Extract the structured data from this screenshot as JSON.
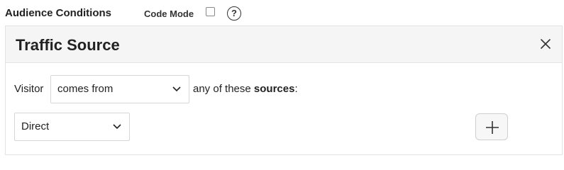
{
  "header": {
    "title": "Audience Conditions",
    "code_mode_label": "Code Mode",
    "help_glyph": "?"
  },
  "panel": {
    "title": "Traffic Source",
    "condition": {
      "subject_label": "Visitor",
      "operator_value": "comes from",
      "mid_text": "any of these ",
      "emphasis_text": "sources",
      "end_text": ":"
    },
    "source_value": "Direct"
  },
  "icons": {
    "help": "question-circle-icon",
    "close": "close-icon",
    "dropdown": "chevron-down-icon",
    "add": "plus-icon"
  },
  "colors": {
    "panel_header_bg": "#f5f5f5",
    "border": "#d6d6d6",
    "text": "#222222"
  }
}
